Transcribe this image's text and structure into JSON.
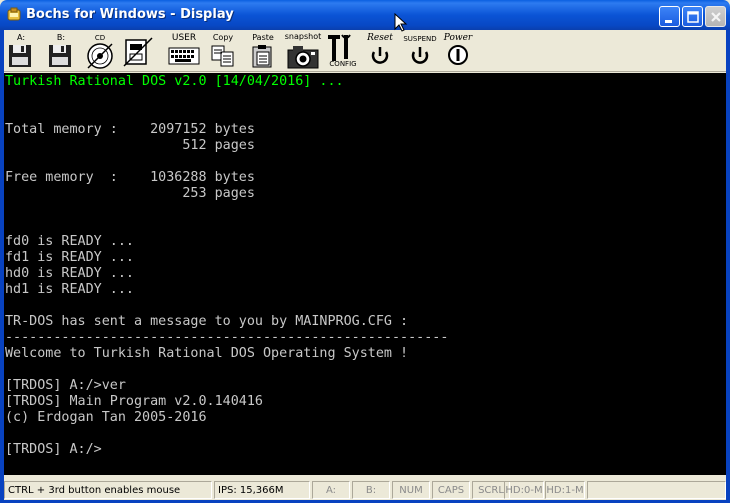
{
  "window": {
    "title": "Bochs for Windows - Display"
  },
  "toolbar": {
    "buttons": [
      {
        "id": "floppy-a",
        "label": "A:",
        "icon": "floppy-icon"
      },
      {
        "id": "floppy-b",
        "label": "B:",
        "icon": "floppy-icon"
      },
      {
        "id": "cdrom",
        "label": "CD",
        "icon": "cdrom-icon"
      },
      {
        "id": "disk",
        "label": "",
        "icon": "disk-icon"
      },
      {
        "id": "user",
        "label": "USER",
        "icon": "keyboard-icon"
      },
      {
        "id": "copy",
        "label": "Copy",
        "icon": "copy-icon"
      },
      {
        "id": "paste",
        "label": "Paste",
        "icon": "paste-icon"
      },
      {
        "id": "snapshot",
        "label": "snapshot",
        "icon": "camera-icon"
      },
      {
        "id": "config",
        "label": "CONFIG",
        "icon": "tools-icon"
      },
      {
        "id": "reset",
        "label": "Reset",
        "icon": "reset-icon"
      },
      {
        "id": "suspend",
        "label": "SUSPEND",
        "icon": "suspend-icon"
      },
      {
        "id": "power",
        "label": "Power",
        "icon": "power-icon"
      }
    ]
  },
  "console": {
    "lines": [
      "Turkish Rational DOS v2.0 [14/04/2016] ...",
      "",
      "",
      "Total memory :    2097152 bytes",
      "                      512 pages",
      "",
      "Free memory  :    1036288 bytes",
      "                      253 pages",
      "",
      "",
      "fd0 is READY ...",
      "fd1 is READY ...",
      "hd0 is READY ...",
      "hd1 is READY ...",
      "",
      "TR-DOS has sent a message to you by MAINPROG.CFG :",
      "-------------------------------------------------------",
      "Welcome to Turkish Rational DOS Operating System !",
      "",
      "[TRDOS] A:/>ver",
      "[TRDOS] Main Program v2.0.140416",
      "(c) Erdogan Tan 2005-2016",
      "",
      "[TRDOS] A:/>"
    ],
    "text_color": "#c8c8c8",
    "header_color": "#00ff00"
  },
  "statusbar": {
    "hint": "CTRL + 3rd button enables mouse",
    "ips": "IPS: 15,366M",
    "a": "A:",
    "b": "B:",
    "num": "NUM",
    "caps": "CAPS",
    "scrl": "SCRL",
    "hd0": "HD:0-M",
    "hd1": "HD:1-M"
  }
}
